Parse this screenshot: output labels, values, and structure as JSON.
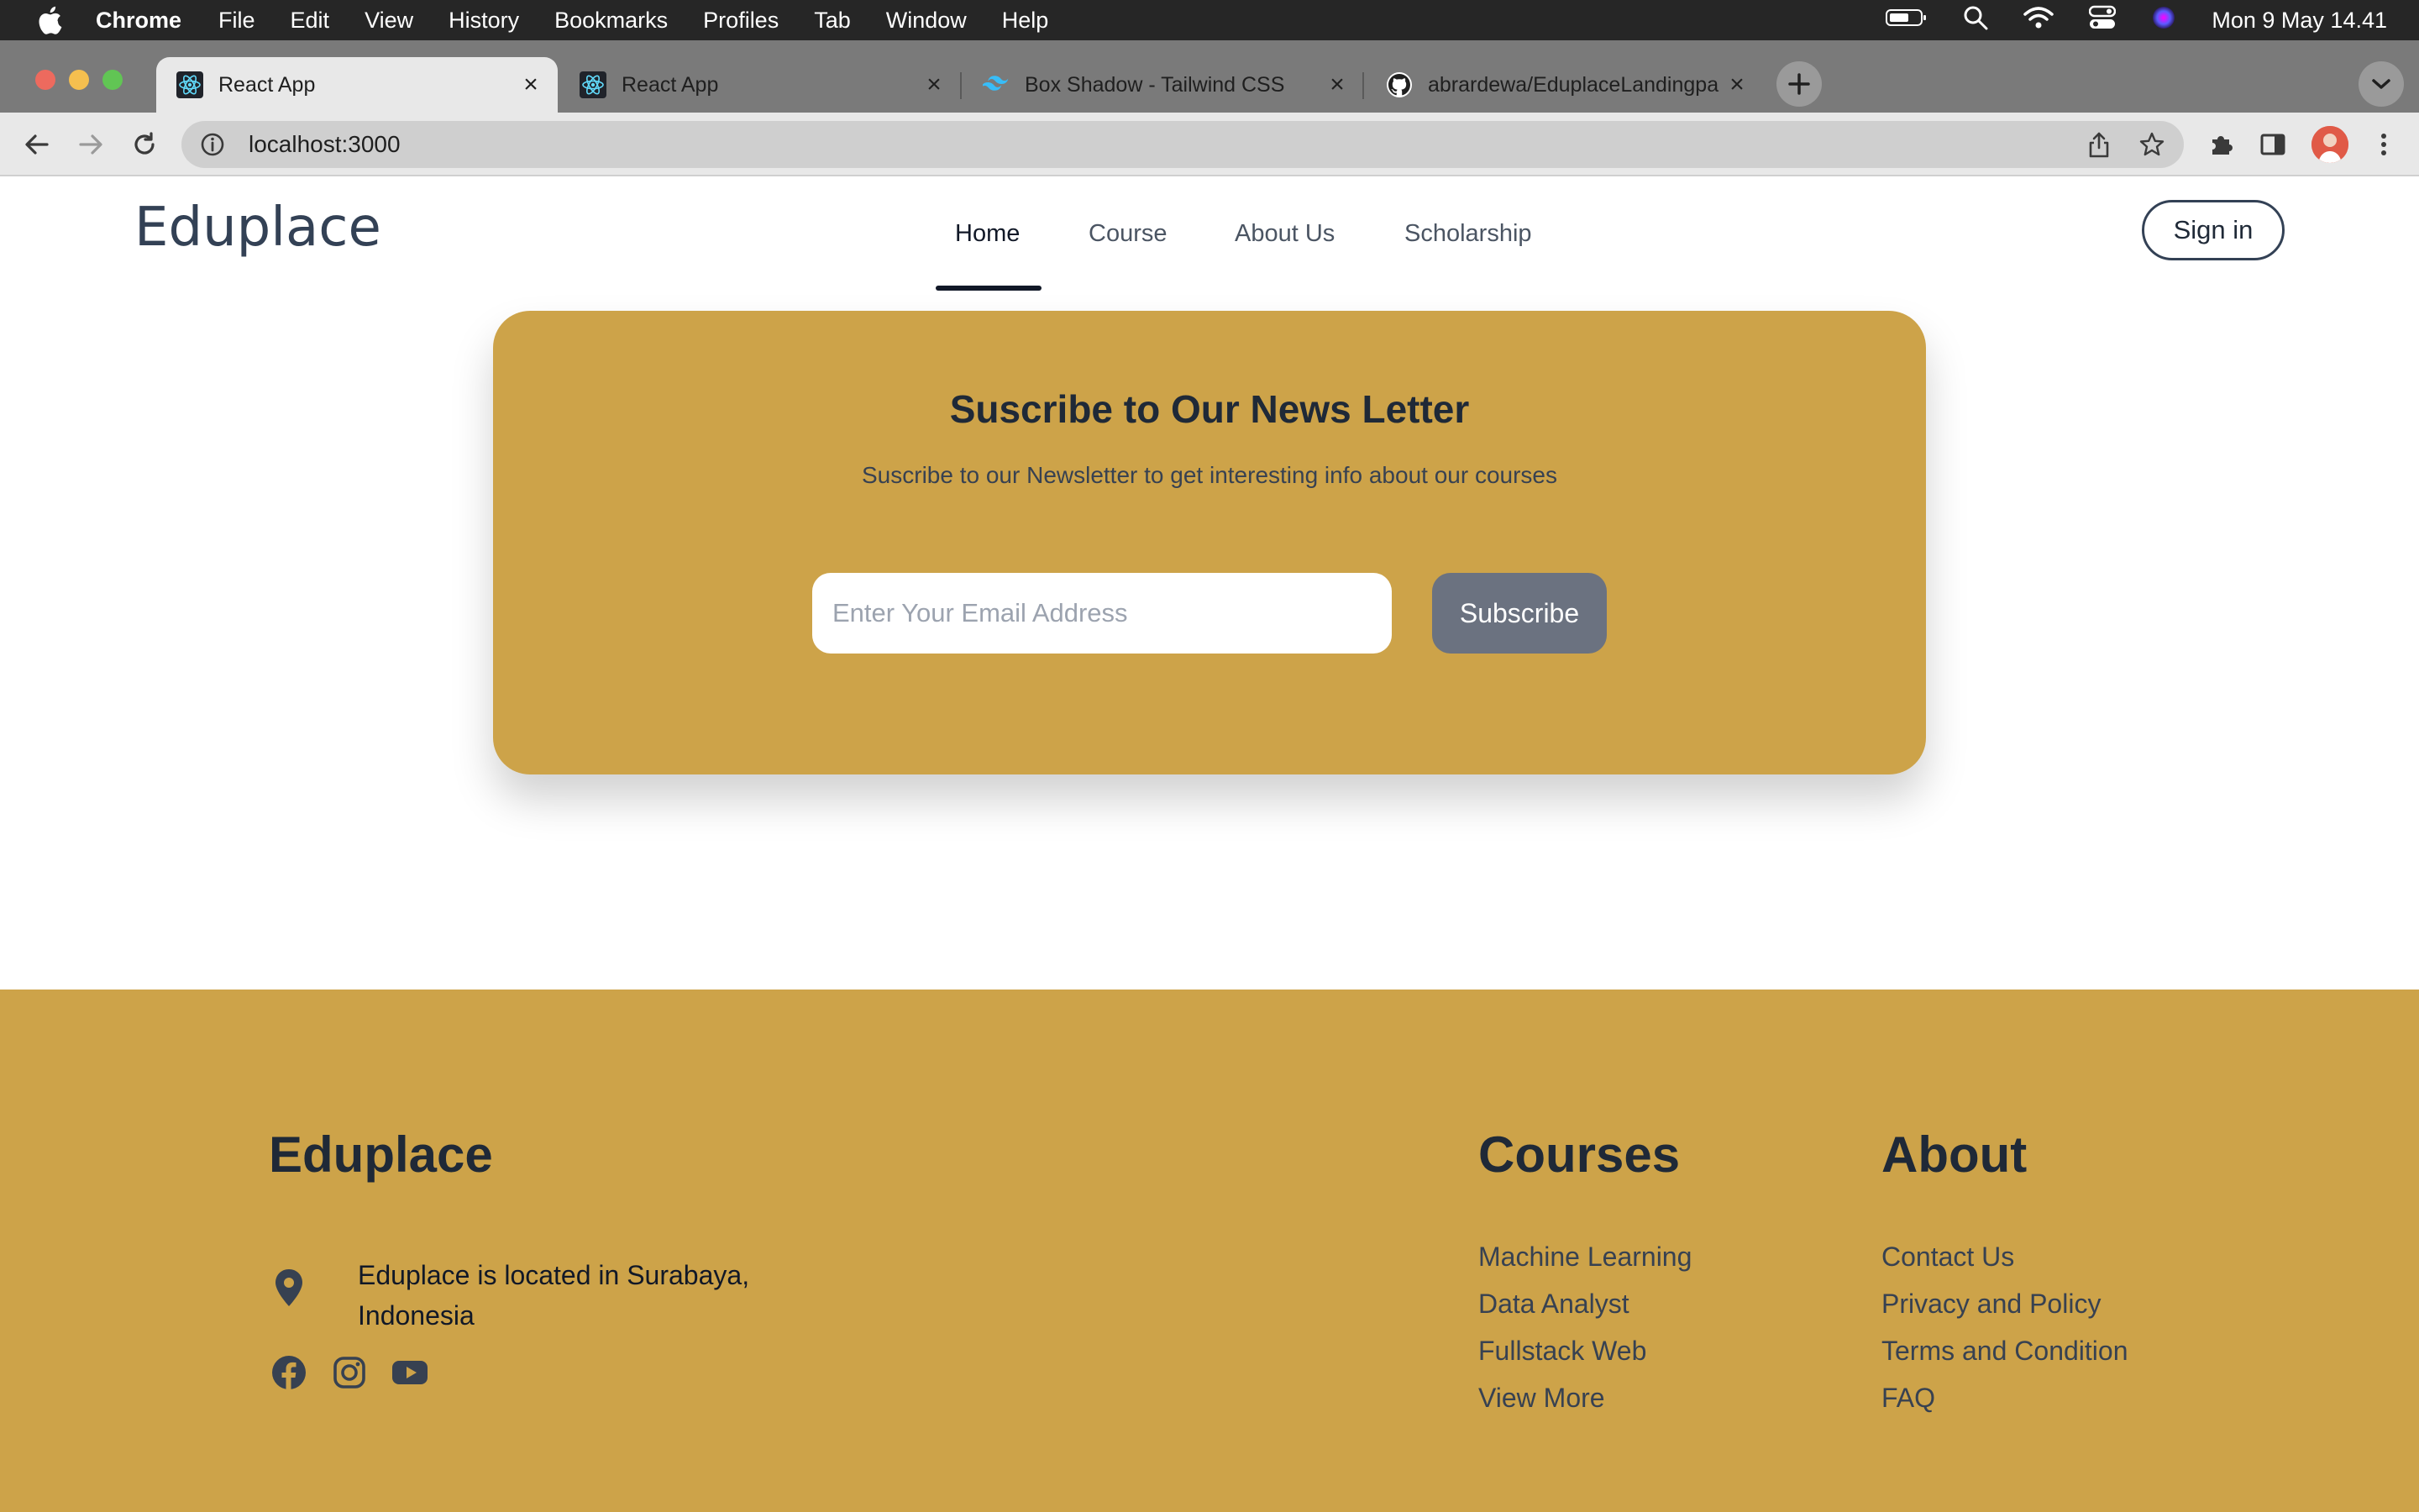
{
  "menubar": {
    "app": "Chrome",
    "items": [
      "File",
      "Edit",
      "View",
      "History",
      "Bookmarks",
      "Profiles",
      "Tab",
      "Window",
      "Help"
    ],
    "clock": "Mon 9 May  14.41"
  },
  "tabs": [
    {
      "title": "React App",
      "icon": "react-icon",
      "active": true
    },
    {
      "title": "React App",
      "icon": "react-icon",
      "active": false
    },
    {
      "title": "Box Shadow - Tailwind CSS",
      "icon": "tailwind-icon",
      "active": false
    },
    {
      "title": "abrardewa/EduplaceLandingpa",
      "icon": "github-icon",
      "active": false
    }
  ],
  "omnibox": {
    "url": "localhost:3000"
  },
  "site": {
    "logo": "Eduplace",
    "nav": [
      "Home",
      "Course",
      "About Us",
      "Scholarship"
    ],
    "active_nav": "Home",
    "signin": "Sign in"
  },
  "newsletter": {
    "title": "Suscribe to Our News Letter",
    "subtitle": "Suscribe to our Newsletter to get interesting info about our courses",
    "email_placeholder": "Enter Your Email Address",
    "button": "Subscribe"
  },
  "footer": {
    "brand": "Eduplace",
    "location": "Eduplace is located in Surabaya, Indonesia",
    "social": [
      "facebook-icon",
      "instagram-icon",
      "youtube-icon"
    ],
    "courses_title": "Courses",
    "courses": [
      "Machine Learning",
      "Data Analyst",
      "Fullstack Web",
      "View More"
    ],
    "about_title": "About",
    "about": [
      "Contact Us",
      "Privacy and Policy",
      "Terms and Condition",
      "FAQ"
    ]
  },
  "colors": {
    "brand_gold": "#cda349",
    "button_gray": "#6b7280",
    "text_dark": "#1f2937"
  }
}
